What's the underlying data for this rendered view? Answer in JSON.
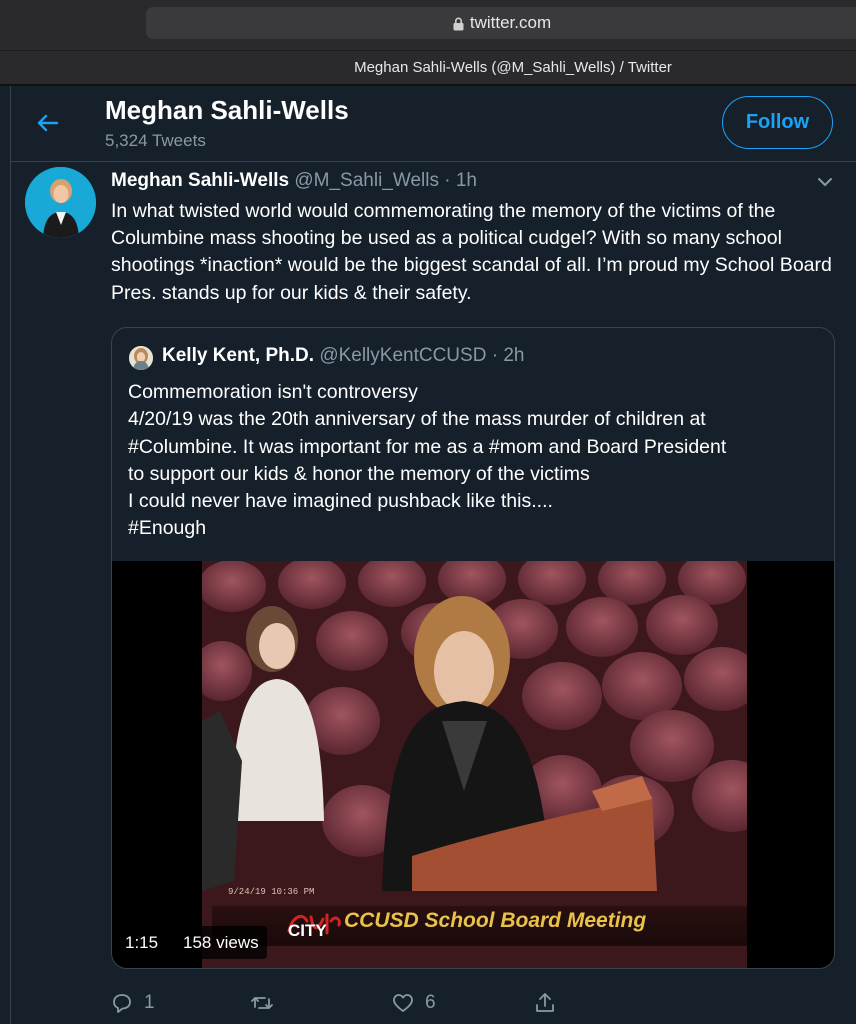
{
  "browser": {
    "url": "twitter.com",
    "tab_title": "Meghan Sahli-Wells (@M_Sahli_Wells) / Twitter"
  },
  "header": {
    "name": "Meghan Sahli-Wells",
    "tweet_count": "5,324 Tweets",
    "follow_label": "Follow"
  },
  "tweet": {
    "author_name": "Meghan Sahli-Wells",
    "author_handle": "@M_Sahli_Wells",
    "separator": "·",
    "time": "1h",
    "text": "In what twisted world would commemorating the memory of the victims of the Columbine mass shooting be used as a political cudgel? With so many school shootings *inaction* would be the biggest scandal of all. I’m proud my School Board Pres. stands up for our kids & their safety."
  },
  "quote": {
    "name": "Kelly Kent, Ph.D.",
    "handle": "@KellyKentCCUSD",
    "separator": "·",
    "time": "2h",
    "lines": [
      "Commemoration isn't controversy",
      "4/20/19 was the 20th anniversary of the mass murder of children at",
      "#Columbine. It was important for me as a #mom and Board President",
      "to support our kids & honor the memory of the victims",
      "I could never have imagined pushback like this....",
      "#Enough"
    ]
  },
  "video": {
    "duration": "1:15",
    "views": "158 views",
    "timestamp": "9/24/19 10:36 PM",
    "banner_city": "CITY",
    "banner_title": "CCUSD School Board Meeting"
  },
  "actions": {
    "replies": "1",
    "retweets": "",
    "likes": "6"
  },
  "colors": {
    "background": "#15202b",
    "accent": "#1da1f2",
    "secondary_text": "#8899a6",
    "border": "#38444d"
  },
  "icons": [
    "lock-icon",
    "back-arrow-icon",
    "caret-down-icon",
    "reply-icon",
    "retweet-icon",
    "like-icon",
    "share-icon"
  ]
}
